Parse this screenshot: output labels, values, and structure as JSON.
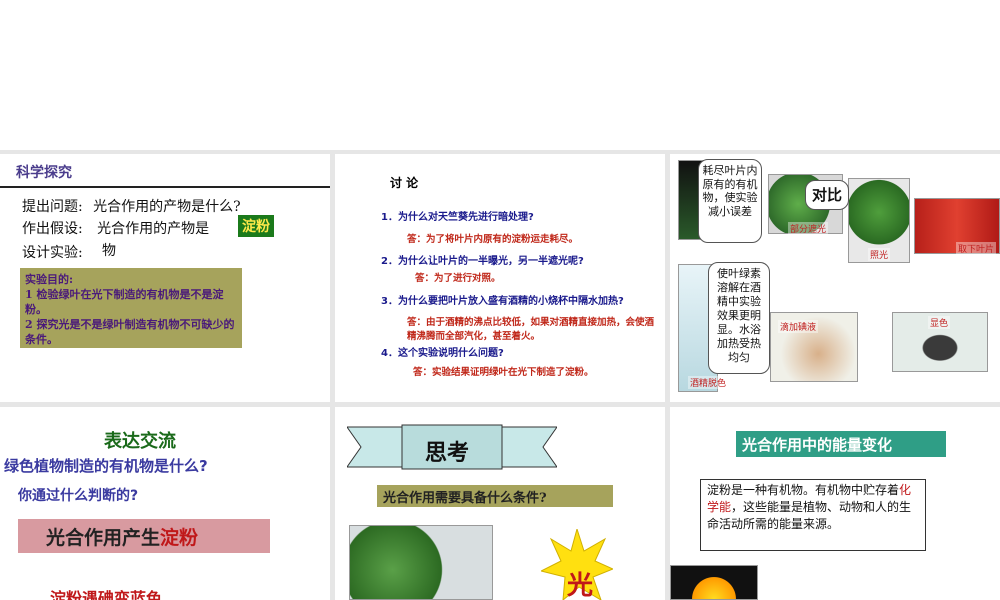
{
  "panel1": {
    "title": "科学探究",
    "q_label": "提出问题:",
    "q_text": "光合作用的产物是什么?",
    "h_label": "作出假设:",
    "h_text": "光合作用的产物是",
    "h_tag": "淀粉",
    "h_tail": "物",
    "d_label": "设计实验:",
    "purpose": [
      "实验目的:",
      "1 检验绿叶在光下制造的有机物是不是淀粉。",
      "2 探究光是不是绿叶制造有机物不可缺少的条件。"
    ]
  },
  "panel2": {
    "heading": "讨  论",
    "items": [
      {
        "q": "1．为什么对天竺葵先进行暗处理?",
        "a": "答：为了将叶片内原有的淀粉运走耗尽。"
      },
      {
        "q": "2．为什么让叶片的一半曝光，另一半遮光呢?",
        "a": "答：为了进行对照。"
      },
      {
        "q": "3．为什么要把叶片放入盛有酒精的小烧杯中隔水加热?",
        "a": "答：由于酒精的沸点比较低，如果对酒精直接加热，会使酒精沸腾而全部汽化，甚至着火。"
      },
      {
        "q": "4．这个实验说明什么问题?",
        "a": "答：实验结果证明绿叶在光下制造了淀粉。"
      }
    ]
  },
  "panel3": {
    "bubble1": "耗尽叶片内原有的有机物，使实验减小误差",
    "bubble2": "对比",
    "bubble3": "使叶绿素溶解在酒精中实验效果更明显。水浴加热受热均匀",
    "captions": [
      "部分遮光",
      "照光",
      "取下叶片",
      "滴加碘液",
      "显色",
      "酒精脱色"
    ]
  },
  "panel4": {
    "heading": "表达交流",
    "q1": "绿色植物制造的有机物是什么?",
    "q2": "你通过什么判断的?",
    "answer_prefix": "光合作用产生",
    "answer_highlight": "淀粉",
    "footer": "淀粉遇碘变蓝色"
  },
  "panel5": {
    "banner": "思考",
    "question": "光合作用需要具备什么条件?",
    "star_text": "光"
  },
  "panel6": {
    "heading": "光合作用中的能量变化",
    "body_prefix": "淀粉是一种有机物。有机物中贮存着",
    "body_highlight": "化学能",
    "body_suffix": "，这些能量是植物、动物和人的生命活动所需的能量来源。"
  },
  "colors": {
    "accent_green": "#1b7a1b",
    "answer_red": "#c0281a",
    "question_blue": "#1a1a8c",
    "heading_teal": "#2f9e86"
  }
}
